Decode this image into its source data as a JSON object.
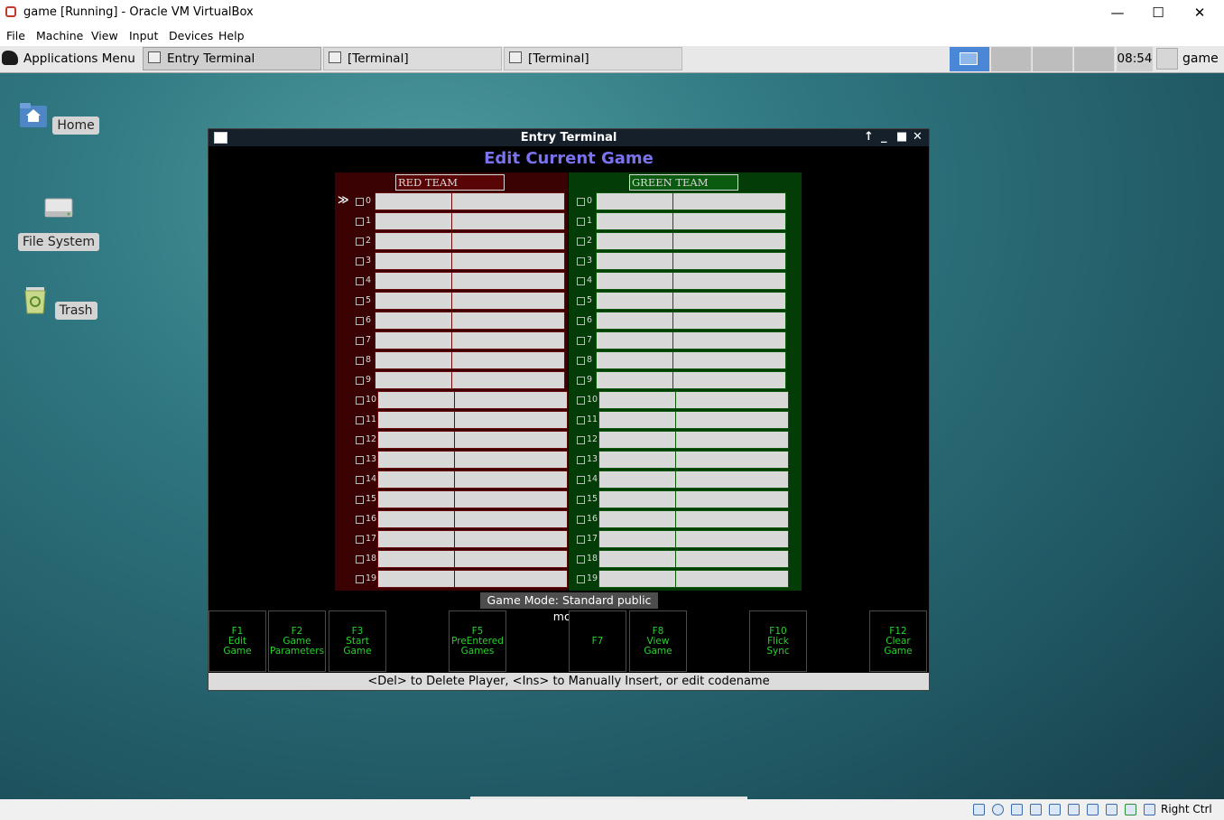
{
  "host_window": {
    "title": "game [Running] - Oracle VM VirtualBox",
    "minimize": "—",
    "maximize": "☐",
    "close": "✕"
  },
  "host_menu": [
    "File",
    "Machine",
    "View",
    "Input",
    "Devices",
    "Help"
  ],
  "panel": {
    "applications_menu": "Applications Menu",
    "tasks": [
      "Entry Terminal",
      "[Terminal]",
      "[Terminal]"
    ],
    "clock": "08:54",
    "user": "game"
  },
  "desktop_icons": [
    "Home",
    "File System",
    "Trash"
  ],
  "terminal_window": {
    "title": "Entry Terminal",
    "heading": "Edit Current Game",
    "red_team": "RED TEAM",
    "green_team": "GREEN TEAM",
    "player_numbers": [
      "0",
      "1",
      "2",
      "3",
      "4",
      "5",
      "6",
      "7",
      "8",
      "9",
      "10",
      "11",
      "12",
      "13",
      "14",
      "15",
      "16",
      "17",
      "18",
      "19"
    ],
    "game_mode": "Game Mode: Standard public mode",
    "function_keys": [
      "F1\nEdit\nGame",
      "F2\nGame\nParameters",
      "F3\nStart\nGame",
      "F5\nPreEntered\nGames",
      "F7",
      "F8\nView\nGame",
      "F10\nFlick\nSync",
      "F12\nClear\nGame"
    ],
    "help_text": "<Del> to Delete Player, <Ins> to Manually Insert, or edit codename",
    "cursor_marker": "≫"
  },
  "statusbar": {
    "host_key": "Right Ctrl"
  },
  "colors": {
    "red_team_bg": "#3a0202",
    "green_team_bg": "#033c06",
    "heading": "#7a72ee",
    "fkey_text": "#29d12e"
  }
}
